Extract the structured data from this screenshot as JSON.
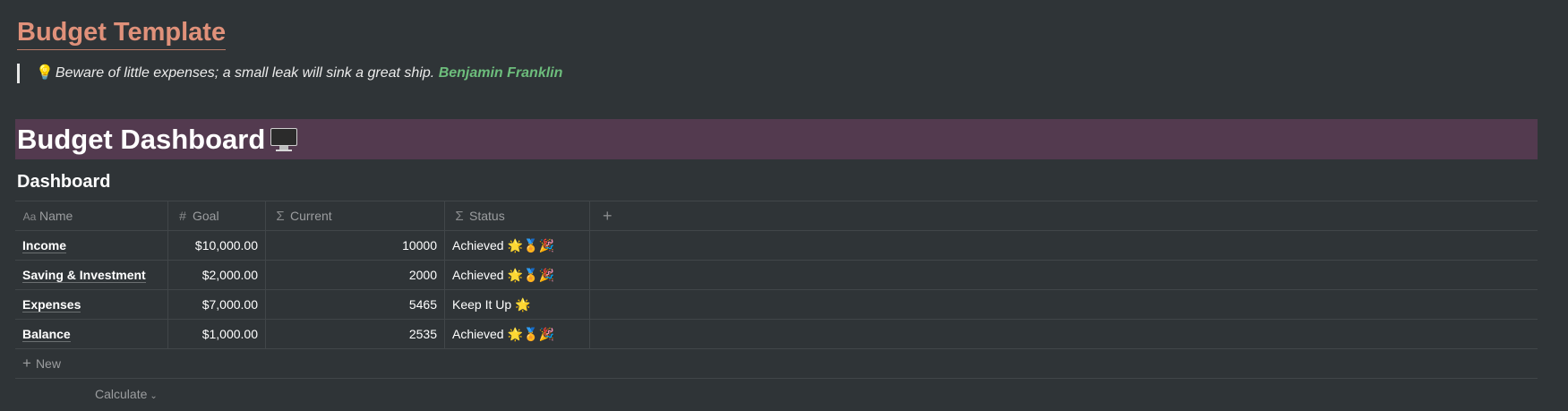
{
  "page": {
    "title": "Budget Template",
    "quote": {
      "icon": "💡",
      "text": "Beware of little expenses; a small leak will sink a great ship.",
      "author": "Benjamin Franklin"
    }
  },
  "banner": {
    "title": "Budget Dashboard",
    "icon": "desktop-computer-icon",
    "background": "#533a4f"
  },
  "database": {
    "title": "Dashboard",
    "columns": [
      {
        "label": "Name",
        "icon": "Aa"
      },
      {
        "label": "Goal",
        "icon": "#"
      },
      {
        "label": "Current",
        "icon": "Σ"
      },
      {
        "label": "Status",
        "icon": "Σ"
      }
    ],
    "add_column_icon": "+",
    "rows": [
      {
        "name": "Income",
        "goal": "$10,000.00",
        "current": "10000",
        "status": "Achieved",
        "status_emoji": "🌟🏅🎉"
      },
      {
        "name": "Saving & Investment",
        "goal": "$2,000.00",
        "current": "2000",
        "status": "Achieved",
        "status_emoji": "🌟🏅🎉"
      },
      {
        "name": "Expenses",
        "goal": "$7,000.00",
        "current": "5465",
        "status": "Keep It Up",
        "status_emoji": "🌟"
      },
      {
        "name": "Balance",
        "goal": "$1,000.00",
        "current": "2535",
        "status": "Achieved",
        "status_emoji": "🌟🏅🎉"
      }
    ],
    "new_label": "New",
    "calculate_label": "Calculate"
  },
  "colors": {
    "background": "#2f3437",
    "title": "#e0917a",
    "author": "#6dbd7c",
    "muted": "#9b9d9f"
  }
}
